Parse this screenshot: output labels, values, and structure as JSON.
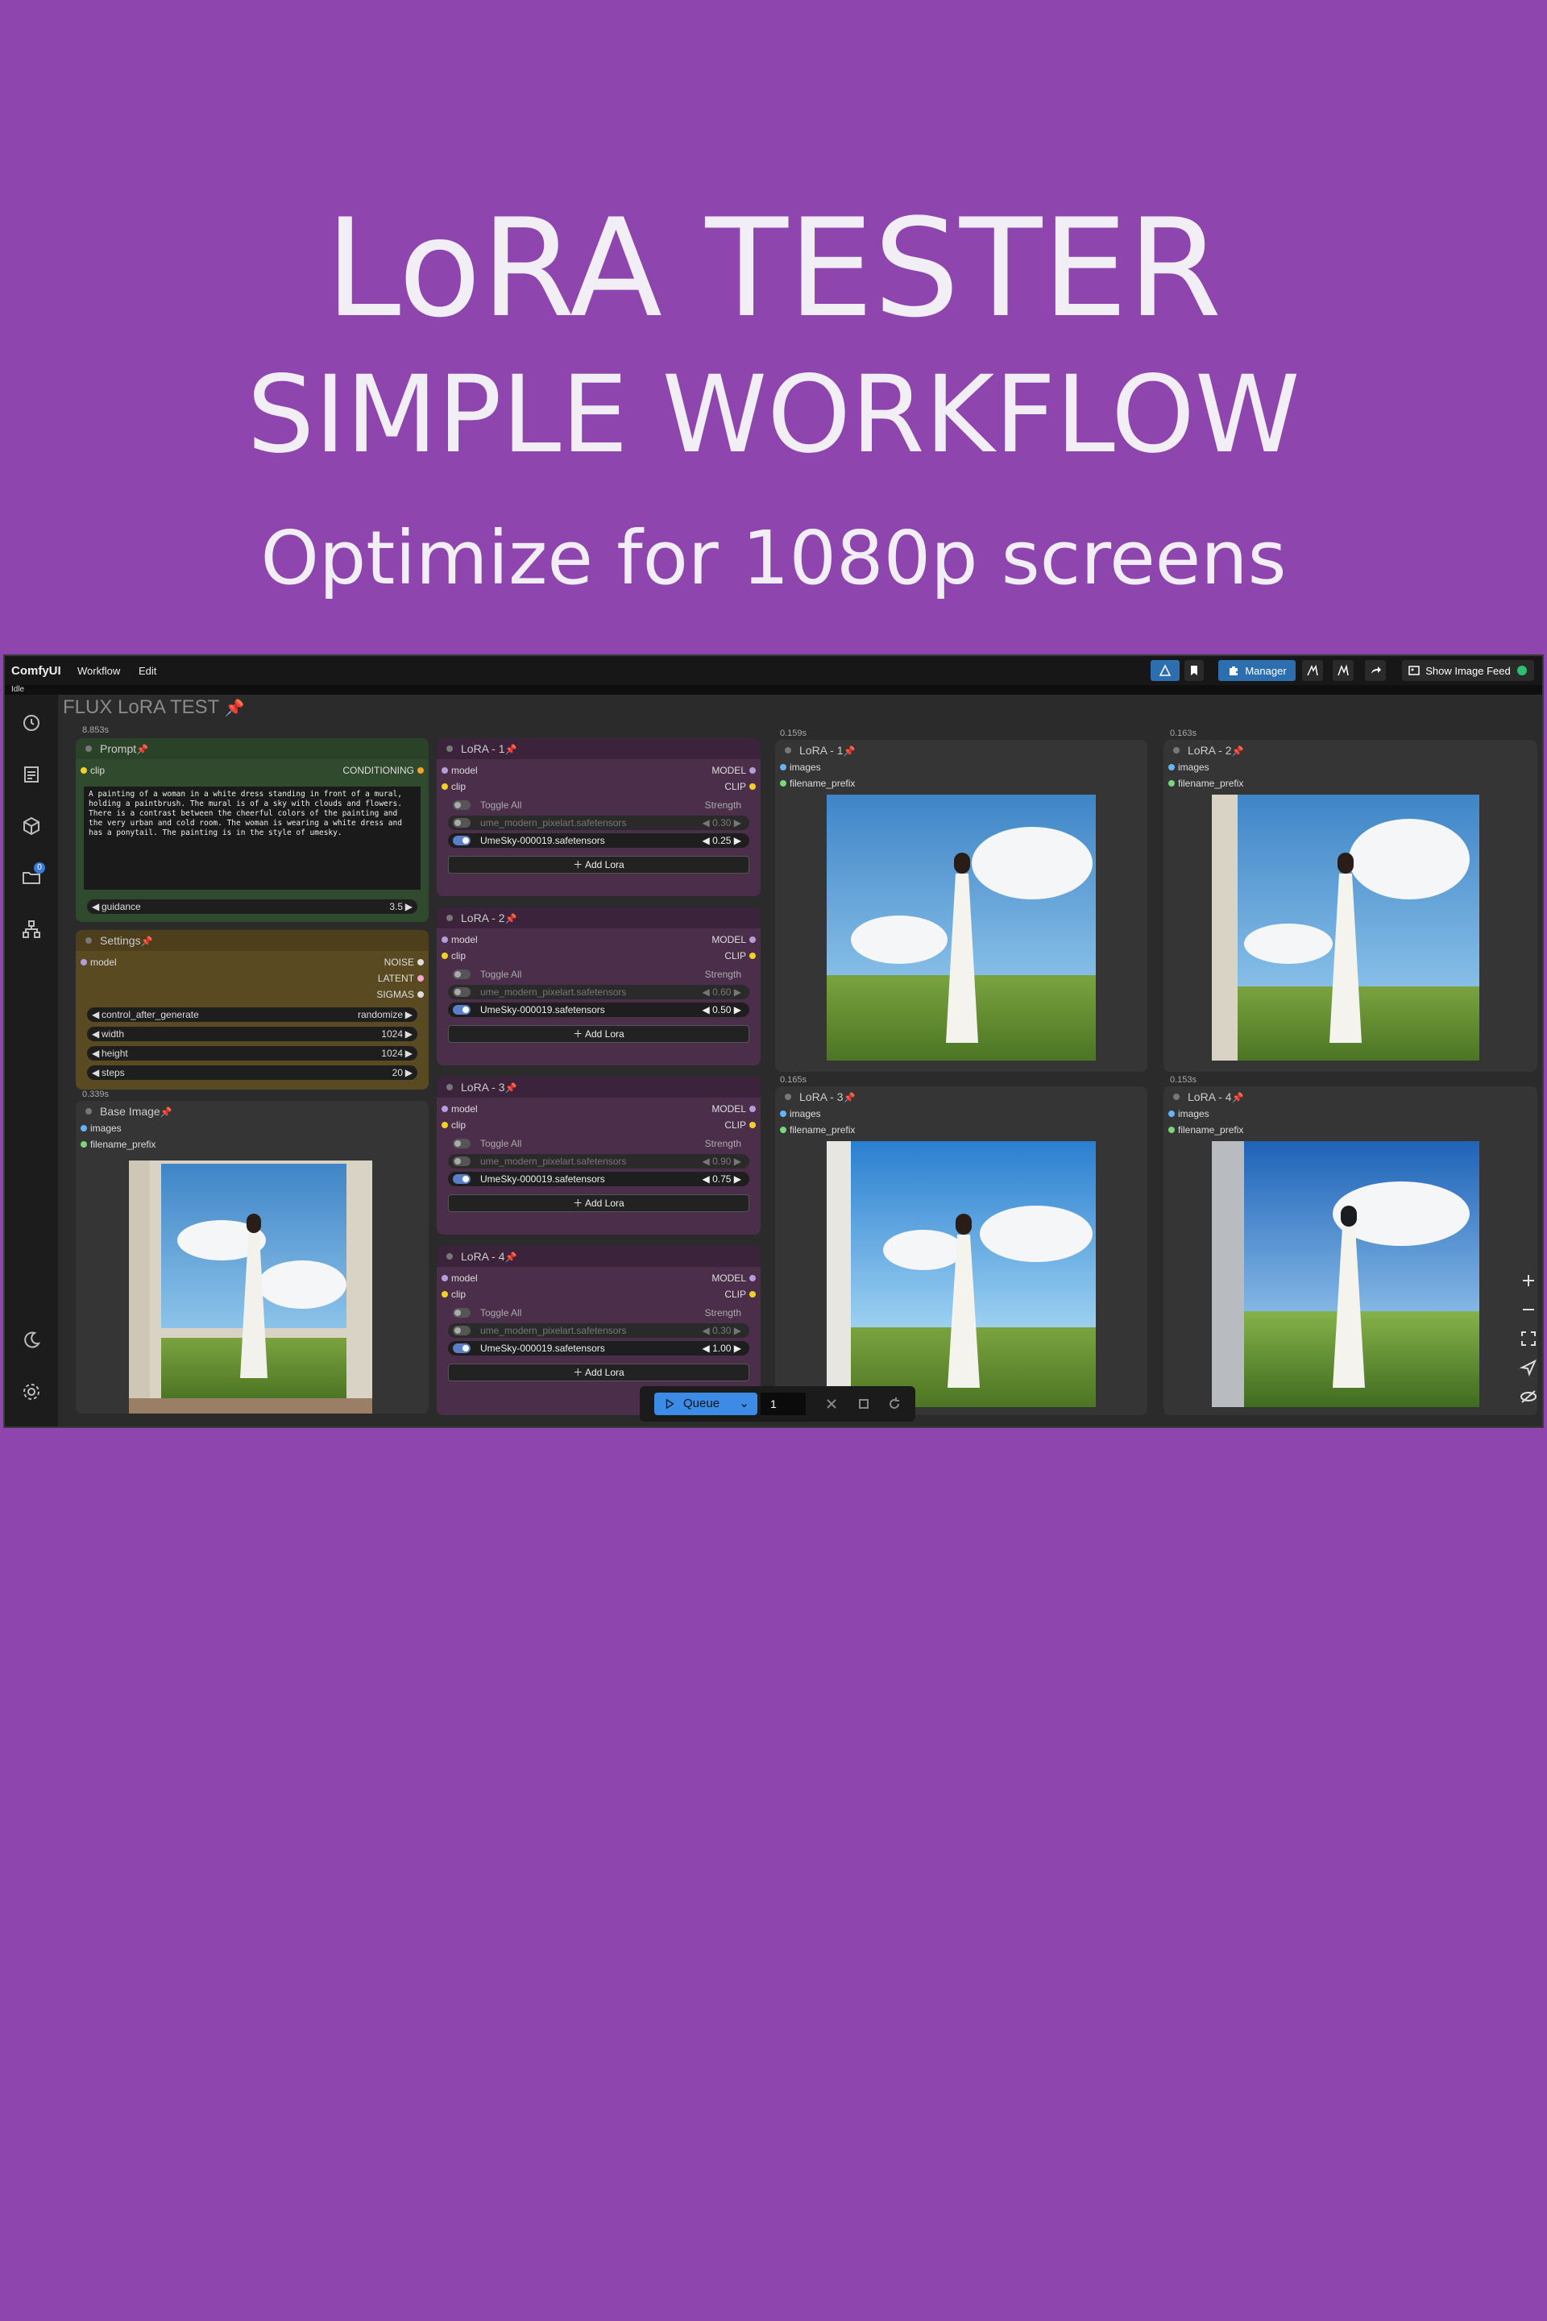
{
  "hero": {
    "title": "LoRA TESTER",
    "subtitle": "SIMPLE WORKFLOW",
    "tagline": "Optimize for 1080p screens"
  },
  "menubar": {
    "brand": "ComfyUI",
    "menu_workflow": "Workflow",
    "menu_edit": "Edit",
    "manager_label": "Manager",
    "show_feed_label": "Show Image Feed",
    "accent": "#2d6fae"
  },
  "status": "Idle",
  "sidebar": {
    "icons": [
      "history-icon",
      "queue-list-icon",
      "model-library-icon",
      "workflows-folder-icon",
      "node-library-icon",
      "theme-toggle-icon",
      "settings-icon"
    ],
    "workflows_badge": "0"
  },
  "canvas": {
    "group_title": "FLUX LoRA TEST",
    "pin": "📌",
    "timings": {
      "prompt": "8.853s",
      "base": "0.339s",
      "out1": "0.159s",
      "out2": "0.163s",
      "out3": "0.165s",
      "out4": "0.153s"
    }
  },
  "prompt_node": {
    "title": "Prompt",
    "in_clip": "clip",
    "out_conditioning": "CONDITIONING",
    "text": "A painting of a woman in a white dress standing in front of a mural, holding a paintbrush. The mural is of a sky with clouds and flowers. There is a contrast between the cheerful colors of the painting and the very urban and cold room. The woman is wearing a white dress and has a ponytail. The painting is in the style of umesky.",
    "guidance_label": "guidance",
    "guidance_value": "3.5"
  },
  "settings_node": {
    "title": "Settings",
    "in_model": "model",
    "out_noise": "NOISE",
    "out_latent": "LATENT",
    "out_sigmas": "SIGMAS",
    "widgets": [
      {
        "label": "control_after_generate",
        "value": "randomize"
      },
      {
        "label": "width",
        "value": "1024"
      },
      {
        "label": "height",
        "value": "1024"
      },
      {
        "label": "steps",
        "value": "20"
      }
    ]
  },
  "base_image": {
    "title": "Base Image",
    "in_images": "images",
    "in_prefix": "filename_prefix"
  },
  "lora_nodes": [
    {
      "title": "LoRA - 1",
      "in_model": "model",
      "in_clip": "clip",
      "out_model": "MODEL",
      "out_clip": "CLIP",
      "toggle_all": "Toggle All",
      "strength": "Strength",
      "lora_a": "ume_modern_pixelart.safetensors",
      "lora_a_strength": "0.30",
      "lora_b": "UmeSky-000019.safetensors",
      "lora_b_strength": "0.25",
      "add": "Add Lora"
    },
    {
      "title": "LoRA - 2",
      "in_model": "model",
      "in_clip": "clip",
      "out_model": "MODEL",
      "out_clip": "CLIP",
      "toggle_all": "Toggle All",
      "strength": "Strength",
      "lora_a": "ume_modern_pixelart.safetensors",
      "lora_a_strength": "0.60",
      "lora_b": "UmeSky-000019.safetensors",
      "lora_b_strength": "0.50",
      "add": "Add Lora"
    },
    {
      "title": "LoRA - 3",
      "in_model": "model",
      "in_clip": "clip",
      "out_model": "MODEL",
      "out_clip": "CLIP",
      "toggle_all": "Toggle All",
      "strength": "Strength",
      "lora_a": "ume_modern_pixelart.safetensors",
      "lora_a_strength": "0.90",
      "lora_b": "UmeSky-000019.safetensors",
      "lora_b_strength": "0.75",
      "add": "Add Lora"
    },
    {
      "title": "LoRA - 4",
      "in_model": "model",
      "in_clip": "clip",
      "out_model": "MODEL",
      "out_clip": "CLIP",
      "toggle_all": "Toggle All",
      "strength": "Strength",
      "lora_a": "ume_modern_pixelart.safetensors",
      "lora_a_strength": "0.30",
      "lora_b": "UmeSky-000019.safetensors",
      "lora_b_strength": "1.00",
      "add": "Add Lora"
    }
  ],
  "outputs": [
    {
      "title": "LoRA - 1",
      "in_images": "images",
      "in_prefix": "filename_prefix"
    },
    {
      "title": "LoRA - 2",
      "in_images": "images",
      "in_prefix": "filename_prefix"
    },
    {
      "title": "LoRA - 3",
      "in_images": "images",
      "in_prefix": "filename_prefix"
    },
    {
      "title": "LoRA - 4",
      "in_images": "images",
      "in_prefix": "filename_prefix"
    }
  ],
  "queue": {
    "label": "Queue",
    "count": "1"
  },
  "colors": {
    "background": "#8e45ae",
    "prompt_node": "#2f4a2c",
    "settings_node": "#5a4a22",
    "lora_node": "#4a2e4a",
    "queue_button": "#3c8ce7"
  }
}
